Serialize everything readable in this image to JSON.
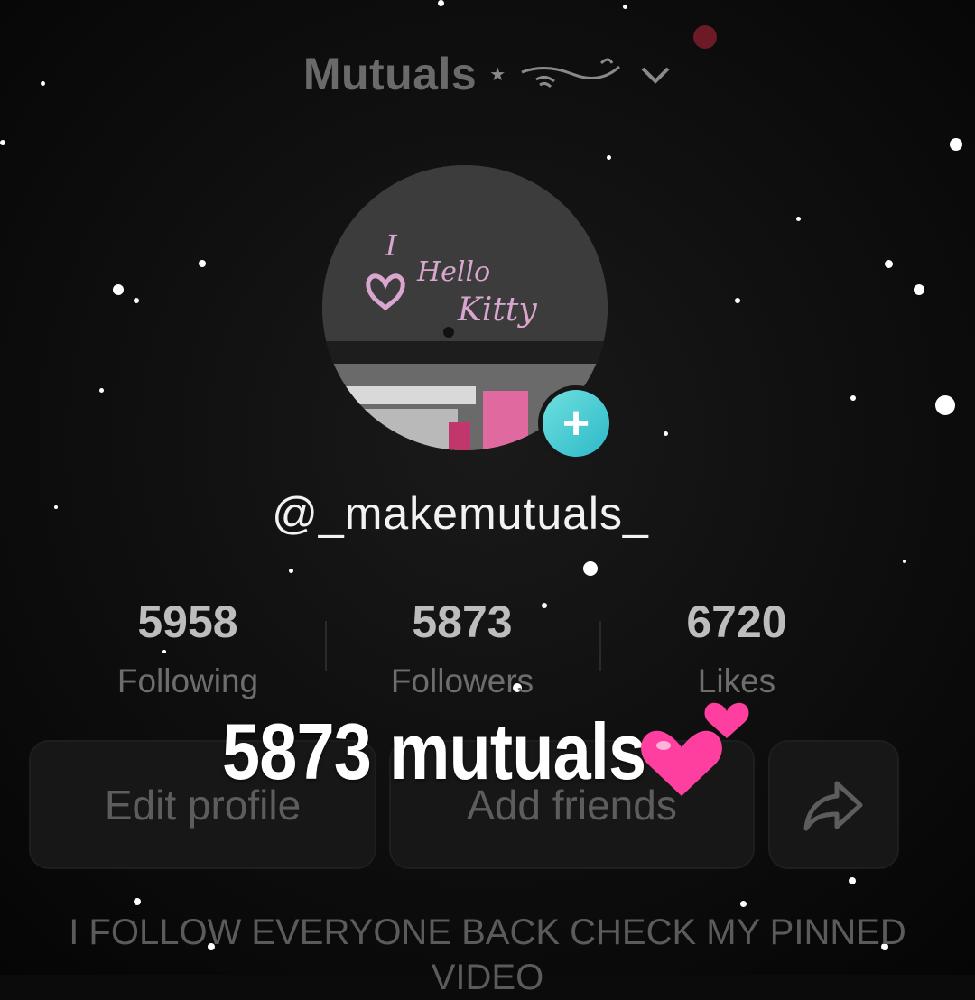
{
  "header": {
    "title": "Mutuals",
    "icons": [
      "star-icon",
      "wave-decoration-icon",
      "chevron-down-icon"
    ],
    "notification_color": "#6b1a26"
  },
  "profile": {
    "username": "@_makemutuals_",
    "avatar_text": [
      "I",
      "Hello",
      "Kitty"
    ],
    "add_icon": "plus-icon",
    "accent_color": "#2cb9c8"
  },
  "stats": [
    {
      "value": "5958",
      "label": "Following"
    },
    {
      "value": "5873",
      "label": "Followers"
    },
    {
      "value": "6720",
      "label": "Likes"
    }
  ],
  "actions": {
    "edit_profile": "Edit profile",
    "add_friends": "Add friends",
    "share_icon": "share-icon"
  },
  "overlay": {
    "caption": "5873 mutuals",
    "emoji": "two-hearts-icon",
    "emoji_color": "#ff3fa0"
  },
  "bio": {
    "line1": "I FOLLOW EVERYONE BACK CHECK MY PINNED",
    "line2": "VIDEO"
  }
}
